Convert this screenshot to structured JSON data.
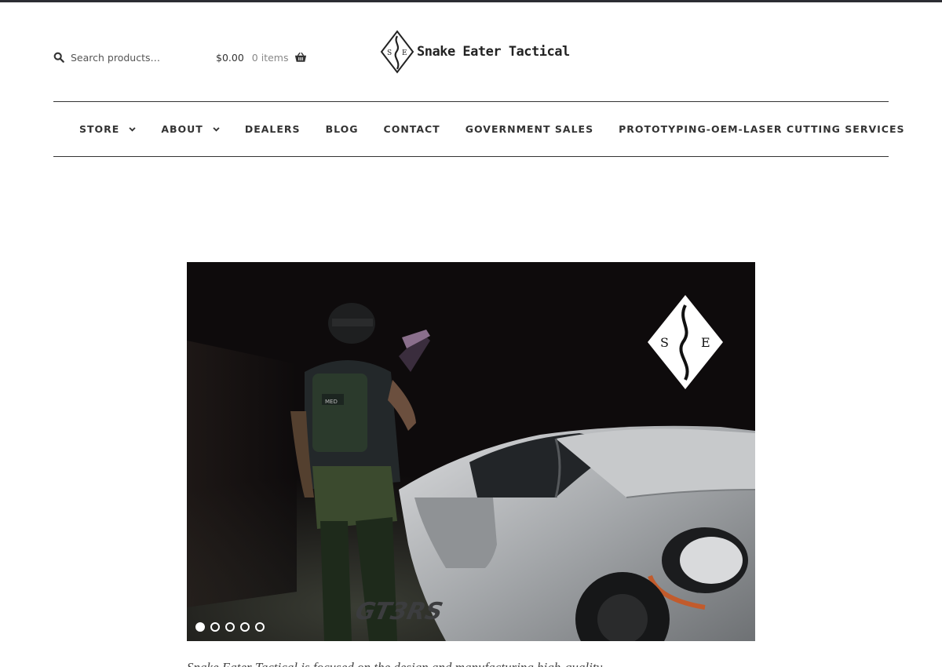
{
  "header": {
    "search": {
      "placeholder": "Search products…"
    },
    "cart": {
      "amount": "$0.00",
      "count": "0 items"
    },
    "logo": {
      "monogram_left": "S",
      "monogram_right": "E",
      "brand": "Snake Eater Tactical"
    }
  },
  "nav": {
    "items": [
      {
        "label": "STORE",
        "has_dropdown": true
      },
      {
        "label": "ABOUT",
        "has_dropdown": true
      },
      {
        "label": "DEALERS",
        "has_dropdown": false
      },
      {
        "label": "BLOG",
        "has_dropdown": false
      },
      {
        "label": "CONTACT",
        "has_dropdown": false
      },
      {
        "label": "GOVERNMENT SALES",
        "has_dropdown": false
      },
      {
        "label": "PROTOTYPING-OEM-LASER CUTTING SERVICES",
        "has_dropdown": false
      }
    ]
  },
  "slider": {
    "logo_left": "S",
    "logo_right": "E",
    "patch_text": "MED",
    "car_text": "GT3RS",
    "slide_count": 5,
    "active_index": 0
  },
  "caption": {
    "text": "Snake Eater Tactical is focused on the design and manufacturing high-quality"
  },
  "colors": {
    "topbar": "#2c2d33",
    "text": "#333333",
    "slider_bg": "#0e0b0c"
  }
}
